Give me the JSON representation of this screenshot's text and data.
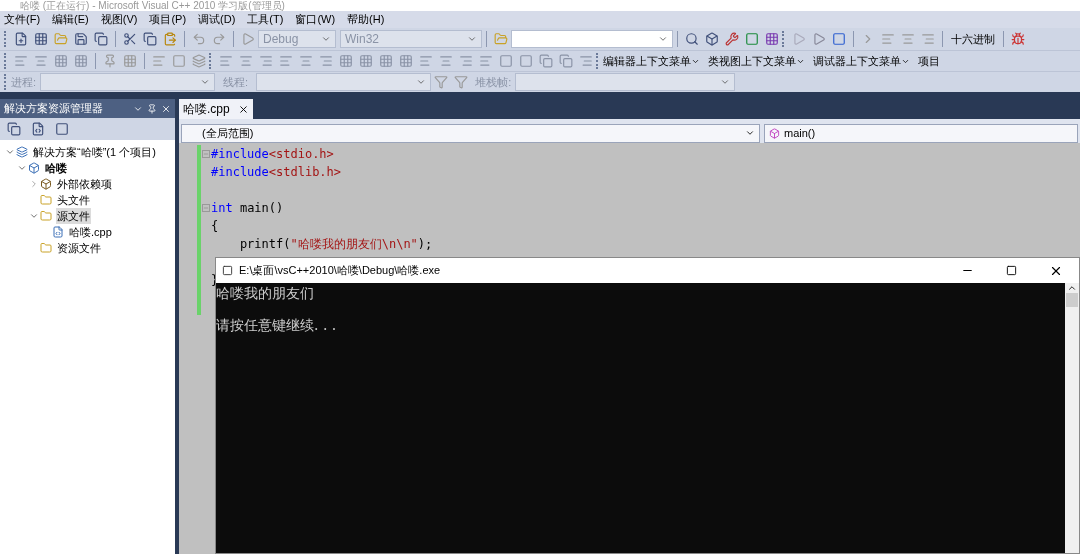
{
  "window": {
    "title": "哈喽 (正在运行) - Microsoft Visual C++ 2010 学习版(管理员)"
  },
  "menu": [
    "文件(F)",
    "编辑(E)",
    "视图(V)",
    "项目(P)",
    "调试(D)",
    "工具(T)",
    "窗口(W)",
    "帮助(H)"
  ],
  "toolbar": {
    "config": "Debug",
    "platform": "Win32",
    "hex_button": "十六进制"
  },
  "context_menus": [
    "编辑器上下文菜单",
    "类视图上下文菜单",
    "调试器上下文菜单",
    "项目"
  ],
  "debug_location": {
    "process_label": "进程:",
    "thread_label": "线程:",
    "stack_label": "堆栈帧:"
  },
  "solution_explorer": {
    "title": "解决方案资源管理器",
    "tree": [
      {
        "label": "解决方案“哈喽”(1 个项目)",
        "kind": "solution",
        "expanded": true,
        "selected": false,
        "children": [
          {
            "label": "哈喽",
            "kind": "project",
            "expanded": true,
            "selected": false,
            "children": [
              {
                "label": "外部依赖项",
                "kind": "deps",
                "expanded": false,
                "selected": false
              },
              {
                "label": "头文件",
                "kind": "folder",
                "selected": false
              },
              {
                "label": "源文件",
                "kind": "folder",
                "expanded": true,
                "selected": true,
                "children": [
                  {
                    "label": "哈喽.cpp",
                    "kind": "file",
                    "selected": false
                  }
                ]
              },
              {
                "label": "资源文件",
                "kind": "folder",
                "selected": false
              }
            ]
          }
        ]
      }
    ]
  },
  "editor": {
    "tabs": [
      {
        "label": "哈喽.cpp",
        "selected": true
      }
    ],
    "scope": "(全局范围)",
    "member": "main()",
    "code_blocks": [
      [
        {
          "fold": true,
          "tokens": [
            {
              "text": "#include",
              "kind": "keyword"
            },
            {
              "text": "<stdio.h>",
              "kind": "string"
            }
          ]
        },
        {
          "fold": false,
          "tokens": [
            {
              "text": "#include",
              "kind": "keyword"
            },
            {
              "text": "<stdlib.h>",
              "kind": "string"
            }
          ]
        }
      ],
      [
        {
          "fold": true,
          "tokens": [
            {
              "text": "int",
              "kind": "keyword"
            },
            {
              "text": " main()",
              "kind": "plain"
            }
          ]
        },
        {
          "fold": false,
          "tokens": [
            {
              "text": "{",
              "kind": "plain"
            }
          ]
        },
        {
          "fold": false,
          "tokens": [
            {
              "text": "    printf(",
              "kind": "plain"
            },
            {
              "text": "\"哈喽我的朋友们\\n\\n\"",
              "kind": "string"
            },
            {
              "text": ");",
              "kind": "plain"
            }
          ]
        }
      ],
      [
        {
          "fold": false,
          "tokens": [
            {
              "text": "}",
              "kind": "plain"
            }
          ]
        }
      ]
    ]
  },
  "console": {
    "title": "E:\\桌面\\vsC++2010\\哈喽\\Debug\\哈喽.exe",
    "lines": [
      "哈喽我的朋友们",
      "请按任意键继续. . ."
    ]
  }
}
